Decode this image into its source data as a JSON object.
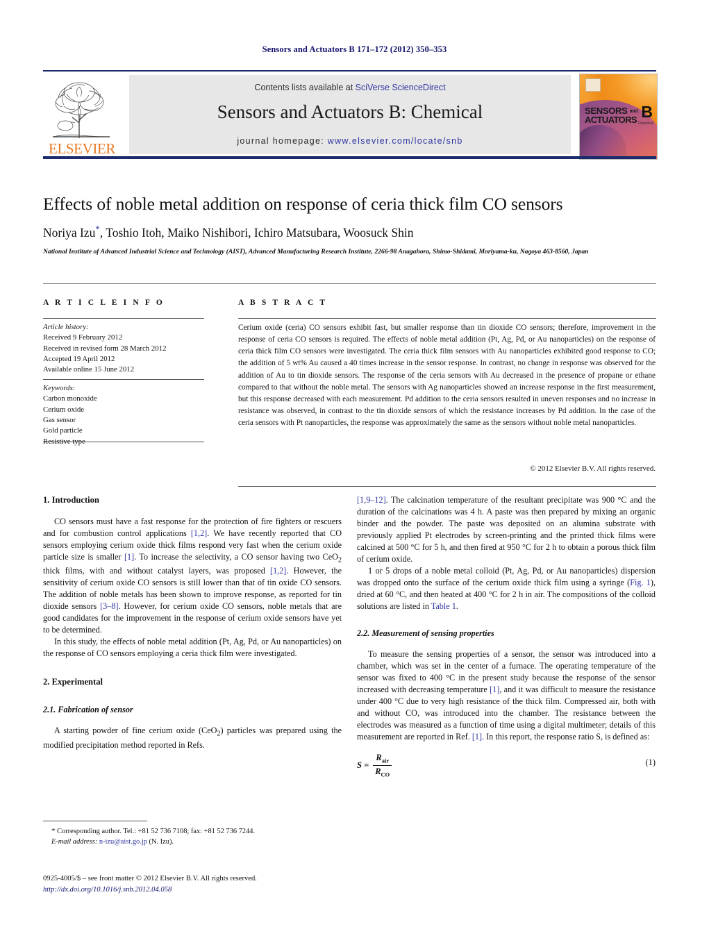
{
  "running_head": "Sensors and Actuators B 171–172 (2012) 350–353",
  "masthead": {
    "publisher_name": "ELSEVIER",
    "contents_prefix": "Contents lists available at ",
    "contents_link": "SciVerse ScienceDirect",
    "journal_title": "Sensors and Actuators B: Chemical",
    "homepage_prefix": "journal homepage: ",
    "homepage_link": "www.elsevier.com/locate/snb",
    "cover": {
      "line1": "SENSORS",
      "line1_suffix": "and",
      "line2": "ACTUATORS",
      "letter": "B",
      "sub": "Chemical"
    }
  },
  "article": {
    "title": "Effects of noble metal addition on response of ceria thick film CO sensors",
    "authors": "Noriya Izu",
    "authors_rest": ", Toshio Itoh, Maiko Nishibori, Ichiro Matsubara, Woosuck Shin",
    "corresponding_marker": "*",
    "affiliation": "National Institute of Advanced Industrial Science and Technology (AIST), Advanced Manufacturing Research Institute, 2266-98 Anagahora, Shimo-Shidami, Moriyama-ku, Nagoya 463-8560, Japan"
  },
  "article_info": {
    "heading": "A R T I C L E   I N F O",
    "history_heading": "Article history:",
    "history": [
      "Received 9 February 2012",
      "Received in revised form 28 March 2012",
      "Accepted 19 April 2012",
      "Available online 15 June 2012"
    ],
    "keywords_heading": "Keywords:",
    "keywords": [
      "Carbon monoxide",
      "Cerium oxide",
      "Gas sensor",
      "Gold particle",
      "Resistive type"
    ]
  },
  "abstract": {
    "heading": "A B S T R A C T",
    "text": "Cerium oxide (ceria) CO sensors exhibit fast, but smaller response than tin dioxide CO sensors; therefore, improvement in the response of ceria CO sensors is required. The effects of noble metal addition (Pt, Ag, Pd, or Au nanoparticles) on the response of ceria thick film CO sensors were investigated. The ceria thick film sensors with Au nanoparticles exhibited good response to CO; the addition of 5 wt% Au caused a 40 times increase in the sensor response. In contrast, no change in response was observed for the addition of Au to tin dioxide sensors. The response of the ceria sensors with Au decreased in the presence of propane or ethane compared to that without the noble metal. The sensors with Ag nanoparticles showed an increase response in the first measurement, but this response decreased with each measurement. Pd addition to the ceria sensors resulted in uneven responses and no increase in resistance was observed, in contrast to the tin dioxide sensors of which the resistance increases by Pd addition. In the case of the ceria sensors with Pt nanoparticles, the response was approximately the same as the sensors without noble metal nanoparticles.",
    "copyright": "© 2012 Elsevier B.V. All rights reserved."
  },
  "sections": {
    "intro_heading": "1.  Introduction",
    "intro_p1_a": "CO sensors must have a fast response for the protection of fire fighters or rescuers and for combustion control applications ",
    "intro_p1_cite1": "[1,2]",
    "intro_p1_b": ". We have recently reported that CO sensors employing cerium oxide thick films respond very fast when the cerium oxide particle size is smaller ",
    "intro_p1_cite2": "[1]",
    "intro_p1_c": ". To increase the selectivity, a CO sensor having two CeO",
    "intro_p1_sub": "2",
    "intro_p1_d": " thick films, with and without catalyst layers, was proposed ",
    "intro_p1_cite3": "[1,2]",
    "intro_p1_e": ". However, the sensitivity of cerium oxide CO sensors is still lower than that of tin oxide CO sensors. The addition of noble metals has been shown to improve response, as reported for tin dioxide sensors ",
    "intro_p1_cite4": "[3–8]",
    "intro_p1_f": ". However, for cerium oxide CO sensors, noble metals that are good candidates for the improvement in the response of cerium oxide sensors have yet to be determined.",
    "intro_p2": "In this study, the effects of noble metal addition (Pt, Ag, Pd, or Au nanoparticles) on the response of CO sensors employing a ceria thick film were investigated.",
    "experimental_heading": "2.  Experimental",
    "fabrication_heading": "2.1.  Fabrication of sensor",
    "fab_p1_a": "A starting powder of fine cerium oxide (CeO",
    "fab_p1_sub": "2",
    "fab_p1_b": ") particles was prepared using the modified precipitation method reported in Refs. ",
    "fab_p1_cite": "[1,9–12]",
    "fab_p1_c": ". The calcination temperature of the resultant precipitate was 900 °C and the duration of the calcinations was 4 h. A paste was then prepared by mixing an organic binder and the powder. The paste was deposited on an alumina substrate with previously applied Pt electrodes by screen-printing and the printed thick films were calcined at 500 °C for 5 h, and then fired at 950 °C for 2 h to obtain a porous thick film of cerium oxide.",
    "fab_p2_a": "1 or 5 drops of a noble metal colloid (Pt, Ag, Pd, or Au nanoparticles) dispersion was dropped onto the surface of the cerium oxide thick film using a syringe (",
    "fab_p2_figref": "Fig. 1",
    "fab_p2_b": "), dried at 60 °C, and then heated at 400 °C for 2 h in air. The compositions of the colloid solutions are listed in ",
    "fab_p2_tableref": "Table 1",
    "fab_p2_c": ".",
    "measurement_heading": "2.2.  Measurement of sensing properties",
    "meas_p1_a": "To measure the sensing properties of a sensor, the sensor was introduced into a chamber, which was set in the center of a furnace. The operating temperature of the sensor was fixed to 400 °C in the present study because the response of the sensor increased with decreasing temperature ",
    "meas_p1_cite1": "[1]",
    "meas_p1_b": ", and it was difficult to measure the resistance under 400 °C due to very high resistance of the thick film. Compressed air, both with and without CO, was introduced into the chamber. The resistance between the electrodes was measured as a function of time using a digital multimeter; details of this measurement are reported in Ref. ",
    "meas_p1_cite2": "[1]",
    "meas_p1_c": ". In this report, the response ratio S, is defined as:",
    "equation": {
      "lhs": "S =",
      "numerator": "R",
      "numerator_sub": "air",
      "denominator": "R",
      "denominator_sub": "CO",
      "number": "(1)"
    }
  },
  "footer": {
    "corresponding_marker": "*",
    "corresponding_text": " Corresponding author. Tel.: +81 52 736 7108; fax: +81 52 736 7244.",
    "email_label": "E-mail address:",
    "email": "n-izu@aist.go.jp",
    "email_owner": "(N. Izu).",
    "imprint": "0925-4005/$ – see front matter © 2012 Elsevier B.V. All rights reserved.",
    "doi": "http://dx.doi.org/10.1016/j.snb.2012.04.058"
  }
}
